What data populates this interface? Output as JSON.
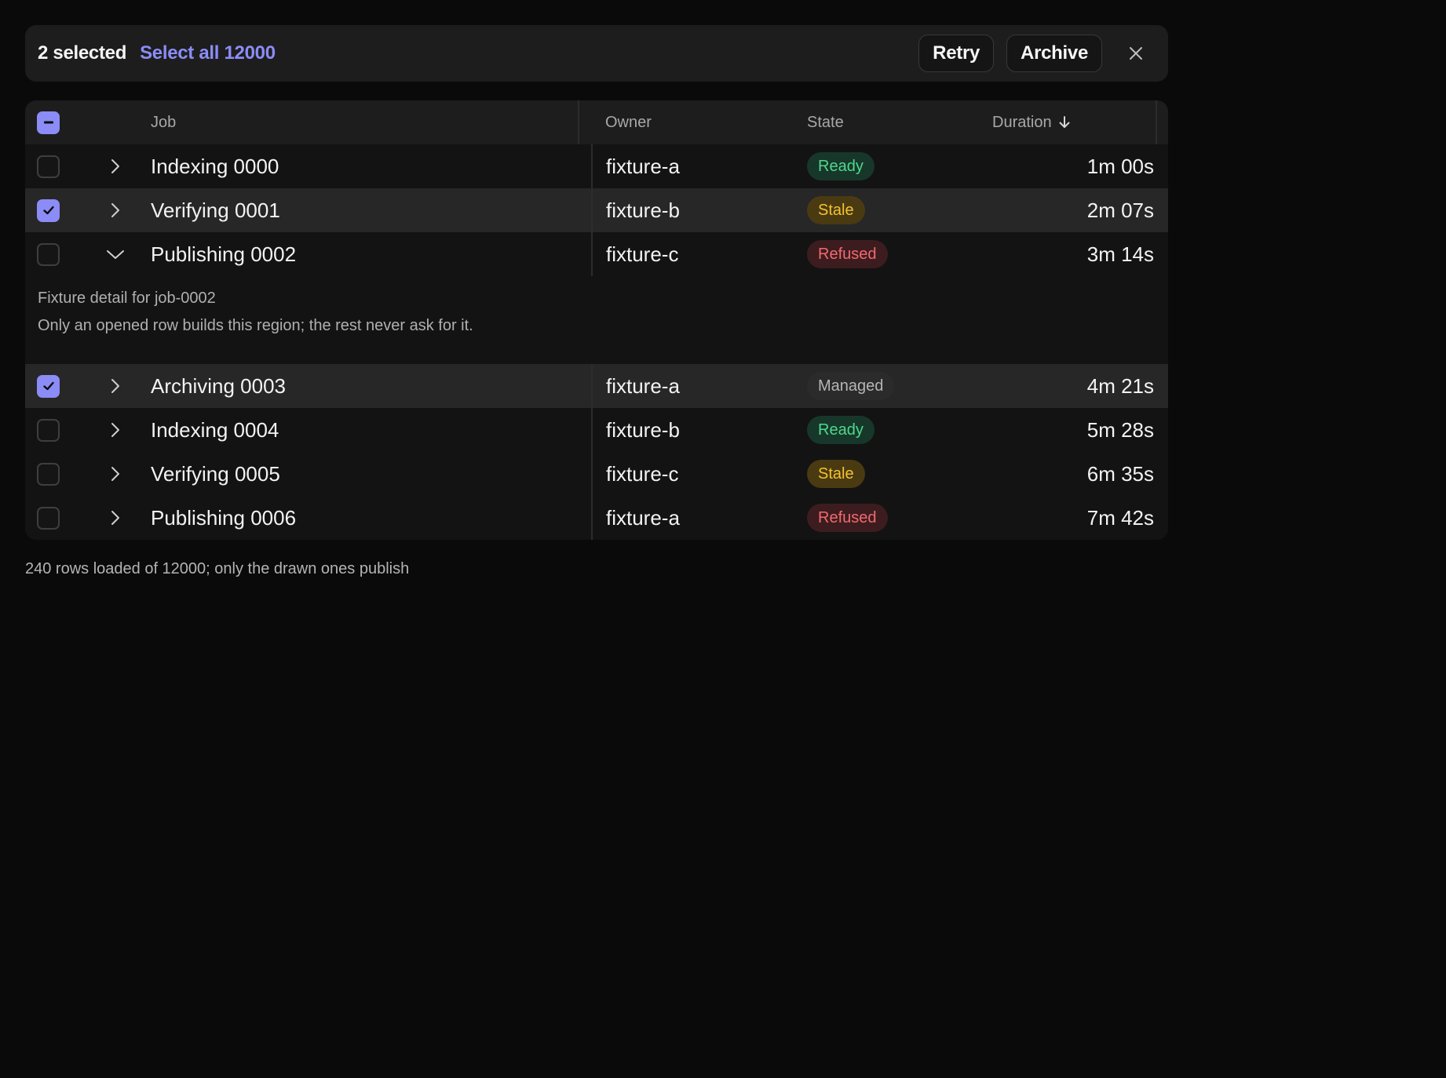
{
  "selection_bar": {
    "count_label": "2 selected",
    "select_all_label": "Select all 12000",
    "retry_label": "Retry",
    "archive_label": "Archive"
  },
  "table": {
    "columns": {
      "job": "Job",
      "owner": "Owner",
      "state": "State",
      "duration": "Duration",
      "sort_icon": "arrow-down-icon"
    },
    "header_checkbox": "indeterminate",
    "rows": [
      {
        "job": "Indexing 0000",
        "owner": "fixture-a",
        "state": "Ready",
        "duration": "1m 00s",
        "checked": false,
        "expanded": false
      },
      {
        "job": "Verifying 0001",
        "owner": "fixture-b",
        "state": "Stale",
        "duration": "2m 07s",
        "checked": true,
        "expanded": false
      },
      {
        "job": "Publishing 0002",
        "owner": "fixture-c",
        "state": "Refused",
        "duration": "3m 14s",
        "checked": false,
        "expanded": true
      },
      {
        "job": "Archiving 0003",
        "owner": "fixture-a",
        "state": "Managed",
        "duration": "4m 21s",
        "checked": true,
        "expanded": false
      },
      {
        "job": "Indexing 0004",
        "owner": "fixture-b",
        "state": "Ready",
        "duration": "5m 28s",
        "checked": false,
        "expanded": false
      },
      {
        "job": "Verifying 0005",
        "owner": "fixture-c",
        "state": "Stale",
        "duration": "6m 35s",
        "checked": false,
        "expanded": false
      },
      {
        "job": "Publishing 0006",
        "owner": "fixture-a",
        "state": "Refused",
        "duration": "7m 42s",
        "checked": false,
        "expanded": false
      }
    ],
    "detail": {
      "title": "Fixture detail for job-0002",
      "text": "Only an opened row builds this region; the rest never ask for it."
    }
  },
  "footer": "240 rows loaded of 12000; only the drawn ones publish",
  "colors": {
    "accent": "#8b8cf6",
    "ready": "#4fd88c",
    "stale": "#f3c22f",
    "refused": "#f06a6f",
    "managed": "#b5b5b5"
  }
}
